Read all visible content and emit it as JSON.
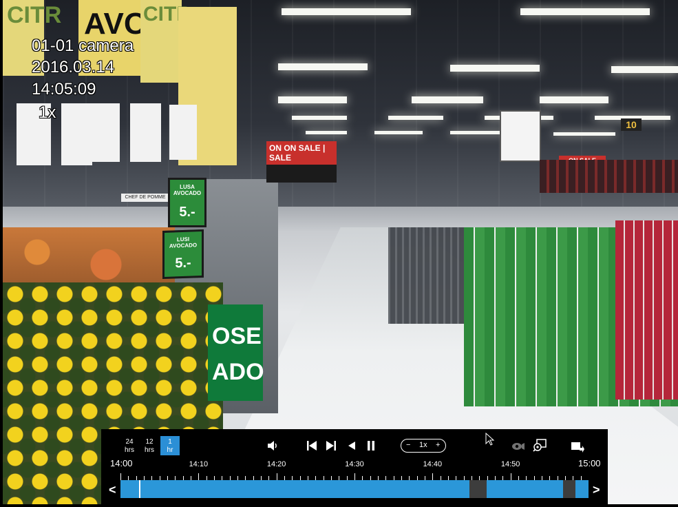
{
  "osd": {
    "camera_name": "01-01 camera",
    "date": "2016.03.14",
    "time": "14:05:09",
    "speed": "1x"
  },
  "scene": {
    "banner_left": "CITR",
    "banner_mid": "AVOC",
    "banner_right": "CITR",
    "sale_board": "ON  ON SALE | SALE",
    "sign_lusa": "LUSA AVOCADO",
    "sign_lusa_price": "5.-",
    "sign_lusi": "LUSI AVOCADO",
    "sign_lusi_price": "5.-",
    "green_sign_line1": "OSE",
    "green_sign_line2": "ADO",
    "aisle_number": "10",
    "shelf_sign": "CHEF DE POMME",
    "on_sale_right": "ON SALE"
  },
  "controls": {
    "range_24": {
      "top": "24",
      "bottom": "hrs"
    },
    "range_12": {
      "top": "12",
      "bottom": "hrs"
    },
    "range_1": {
      "top": "1",
      "bottom": "hr"
    },
    "active_range": "1 hr",
    "speed_minus": "−",
    "speed_value": "1x",
    "speed_plus": "+"
  },
  "timeline": {
    "start_label": "14:00",
    "end_label": "15:00",
    "labels": [
      "14:10",
      "14:20",
      "14:30",
      "14:40",
      "14:50"
    ],
    "playhead_fraction": 0.04,
    "gaps": [
      {
        "start": 0.745,
        "end": 0.783
      },
      {
        "start": 0.946,
        "end": 0.972
      }
    ],
    "prev_arrow": "<",
    "next_arrow": ">"
  },
  "colors": {
    "accent": "#2b97d9",
    "active_button": "#2b8fd6",
    "gap": "#3d3d3d"
  }
}
